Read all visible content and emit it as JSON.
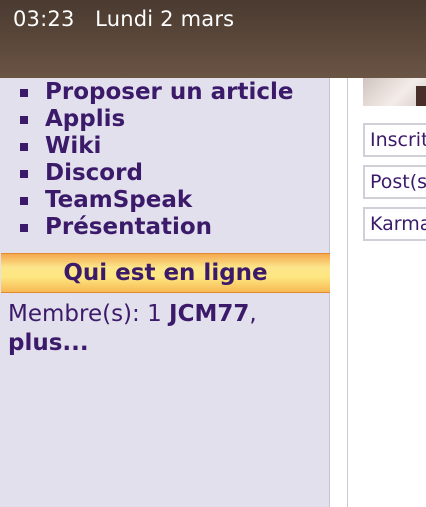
{
  "status_bar": {
    "time": "03:23",
    "date": "Lundi 2 mars"
  },
  "sidebar": {
    "nav_items": [
      {
        "label": "Proposer un article"
      },
      {
        "label": "Applis"
      },
      {
        "label": "Wiki"
      },
      {
        "label": "Discord"
      },
      {
        "label": "TeamSpeak"
      },
      {
        "label": "Présentation"
      }
    ],
    "online": {
      "title": "Qui est en ligne",
      "members_label": "Membre(s): 1 ",
      "member_name": "JCM77",
      "separator": ",",
      "more_link": "plus..."
    }
  },
  "profile_stats": {
    "labels": [
      "Inscrit",
      "Post(s)",
      "Karma"
    ]
  },
  "colors": {
    "link": "#3c1a6a",
    "sidebar_bg": "#e1e0ec",
    "header_gradient_mid": "#fde782",
    "status_bar_bg": "#5a4638"
  }
}
